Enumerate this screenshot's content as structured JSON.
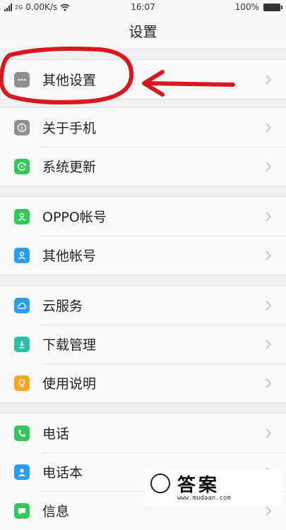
{
  "status_bar": {
    "network_label": "2G",
    "speed": "0.00K/s",
    "time": "16:07",
    "battery": "100%"
  },
  "header": {
    "title": "设置"
  },
  "sections": [
    {
      "items": [
        {
          "label": "其他设置",
          "icon": "more-dots-icon",
          "color": "#8e8e93"
        }
      ]
    },
    {
      "items": [
        {
          "label": "关于手机",
          "icon": "info-icon",
          "color": "#8e8e93"
        },
        {
          "label": "系统更新",
          "icon": "update-icon",
          "color": "#34c759"
        }
      ]
    },
    {
      "items": [
        {
          "label": "OPPO帐号",
          "icon": "user-icon",
          "color": "#34c759"
        },
        {
          "label": "其他帐号",
          "icon": "user-icon",
          "color": "#2b9cf2"
        }
      ]
    },
    {
      "items": [
        {
          "label": "云服务",
          "icon": "cloud-icon",
          "color": "#2b9cf2"
        },
        {
          "label": "下载管理",
          "icon": "download-icon",
          "color": "#2bbfa8"
        },
        {
          "label": "使用说明",
          "icon": "bulb-icon",
          "color": "#f5a623"
        }
      ]
    },
    {
      "items": [
        {
          "label": "电话",
          "icon": "phone-icon",
          "color": "#34c759"
        },
        {
          "label": "电话本",
          "icon": "contacts-icon",
          "color": "#2b9cf2"
        },
        {
          "label": "信息",
          "icon": "message-icon",
          "color": "#34c759"
        }
      ]
    }
  ],
  "annotation_color": "#d7191f",
  "watermark": {
    "text": "答案",
    "url": "www.mudaan.com"
  }
}
